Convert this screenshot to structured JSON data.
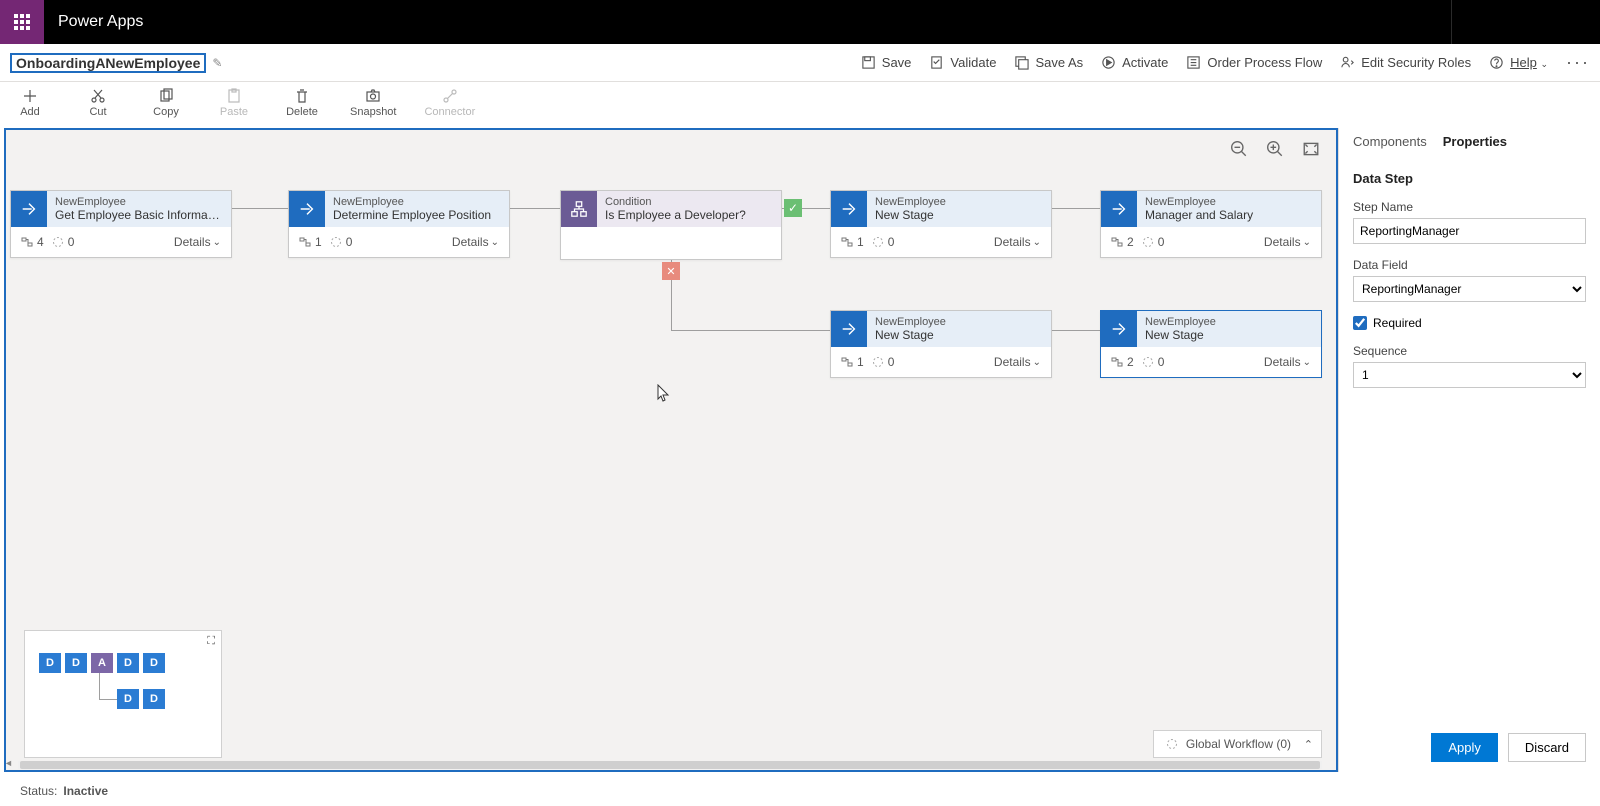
{
  "app": {
    "title": "Power Apps"
  },
  "flow": {
    "name": "OnboardingANewEmployee"
  },
  "topcmds": {
    "save": "Save",
    "validate": "Validate",
    "saveas": "Save As",
    "activate": "Activate",
    "order": "Order Process Flow",
    "security": "Edit Security Roles",
    "help": "Help"
  },
  "toolbar": {
    "add": "Add",
    "cut": "Cut",
    "copy": "Copy",
    "paste": "Paste",
    "delete": "Delete",
    "snapshot": "Snapshot",
    "connector": "Connector"
  },
  "panel": {
    "tab_components": "Components",
    "tab_properties": "Properties",
    "section": "Data Step",
    "step_name_label": "Step Name",
    "step_name_value": "ReportingManager",
    "data_field_label": "Data Field",
    "data_field_value": "ReportingManager",
    "required_label": "Required",
    "required_checked": true,
    "sequence_label": "Sequence",
    "sequence_value": "1",
    "apply": "Apply",
    "discard": "Discard"
  },
  "cards": {
    "c1": {
      "entity": "NewEmployee",
      "title": "Get Employee Basic Information",
      "steps": "4",
      "trig": "0"
    },
    "c2": {
      "entity": "NewEmployee",
      "title": "Determine Employee Position",
      "steps": "1",
      "trig": "0"
    },
    "c3": {
      "entity": "Condition",
      "title": "Is Employee a Developer?"
    },
    "c4": {
      "entity": "NewEmployee",
      "title": "New Stage",
      "steps": "1",
      "trig": "0"
    },
    "c5": {
      "entity": "NewEmployee",
      "title": "Manager and Salary",
      "steps": "2",
      "trig": "0"
    },
    "c6": {
      "entity": "NewEmployee",
      "title": "New Stage",
      "steps": "1",
      "trig": "0"
    },
    "c7": {
      "entity": "NewEmployee",
      "title": "New Stage",
      "steps": "2",
      "trig": "0"
    }
  },
  "details_label": "Details",
  "global_workflow": "Global Workflow (0)",
  "status": {
    "label": "Status:",
    "value": "Inactive"
  }
}
